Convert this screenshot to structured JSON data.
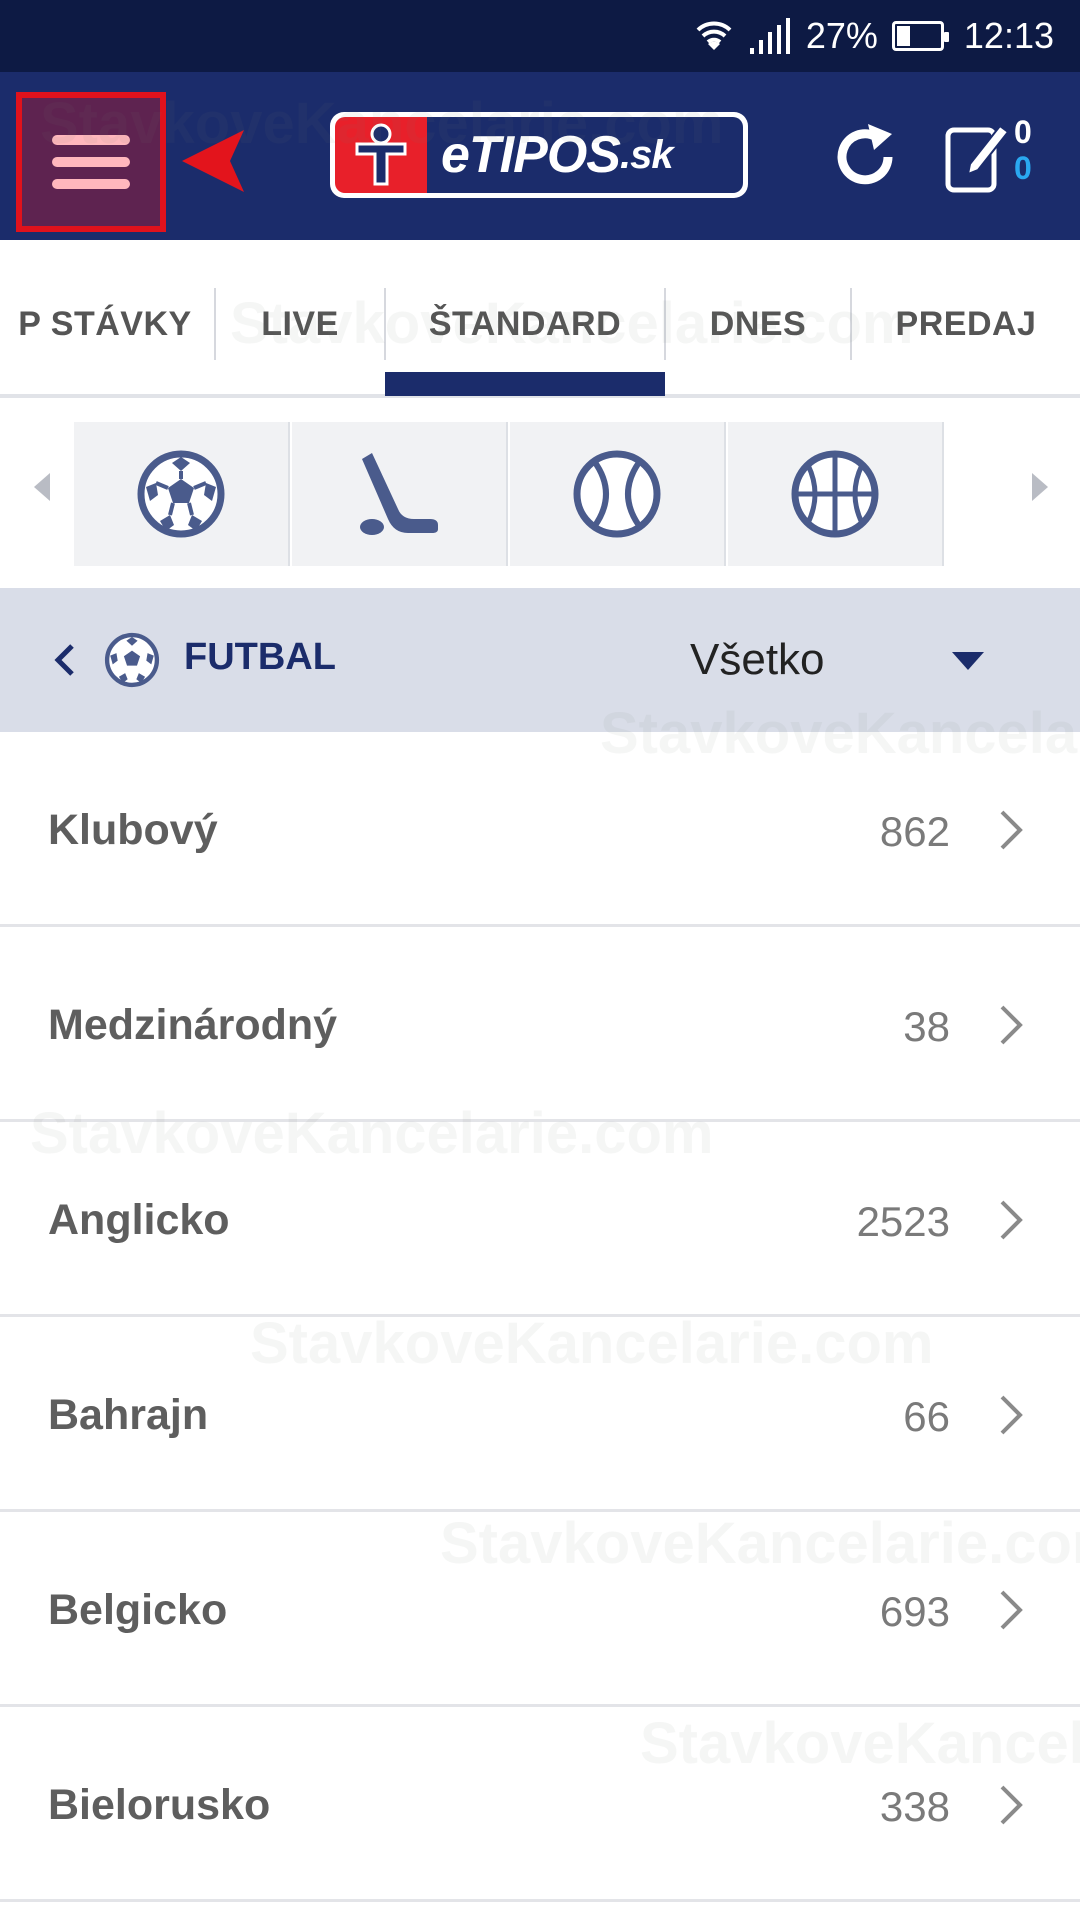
{
  "status_bar": {
    "battery_percent": "27%",
    "time": "12:13"
  },
  "header": {
    "logo_text": "eTIPOS",
    "logo_suffix": ".sk",
    "betslip_count_primary": "0",
    "betslip_count_secondary": "0"
  },
  "tabs": [
    {
      "label": "P STÁVKY"
    },
    {
      "label": "LIVE"
    },
    {
      "label": "ŠTANDARD",
      "active": true
    },
    {
      "label": "DNES"
    },
    {
      "label": "PREDAJ"
    }
  ],
  "sports": [
    "soccer-ball-icon",
    "hockey-stick-icon",
    "tennis-ball-icon",
    "basketball-icon"
  ],
  "subheader": {
    "title": "FUTBAL",
    "filter_value": "Všetko"
  },
  "categories": [
    {
      "label": "Klubový",
      "count": "862"
    },
    {
      "label": "Medzinárodný",
      "count": "38"
    },
    {
      "label": "Anglicko",
      "count": "2523"
    },
    {
      "label": "Bahrajn",
      "count": "66"
    },
    {
      "label": "Belgicko",
      "count": "693"
    },
    {
      "label": "Bielorusko",
      "count": "338"
    }
  ],
  "watermark": "StavkoveKancelarie.com",
  "colors": {
    "brand_navy": "#1b2c6b",
    "brand_red": "#e8202a",
    "status_bar": "#0d1a44",
    "highlight": "#e0121c"
  }
}
